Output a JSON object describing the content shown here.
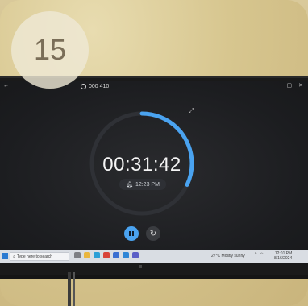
{
  "badge": {
    "number": "15"
  },
  "app": {
    "title": "000 410",
    "window_controls": [
      "—",
      "▢",
      "✕"
    ],
    "back_icon": "back-arrow-icon"
  },
  "timer": {
    "time": "00:31:42",
    "alarm_time": "12:23 PM",
    "progress": 0.32,
    "accent": "#4aa3f0"
  },
  "controls": {
    "pause_icon": "pause-icon",
    "reset_icon": "reset-icon"
  },
  "taskbar": {
    "search_placeholder": "Type here to search",
    "weather": "27°C  Mostly sunny",
    "clock_time": "12:01 PM",
    "clock_date": "8/16/2024"
  }
}
